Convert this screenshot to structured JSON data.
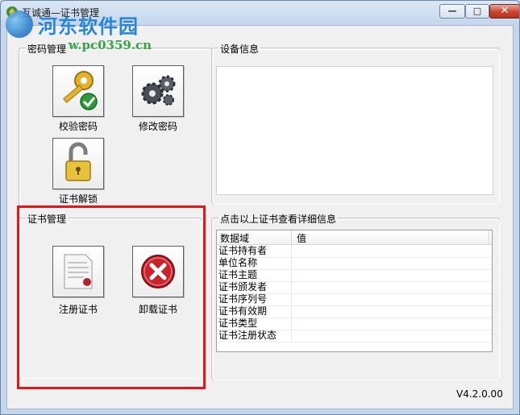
{
  "window": {
    "title": "互诚通—证书管理"
  },
  "watermark": {
    "brand": "河东软件园",
    "url": "www.pc0359.cn"
  },
  "password_group": {
    "title": "密码管理",
    "buttons": [
      {
        "label": "校验密码",
        "icon": "key-check-icon"
      },
      {
        "label": "修改密码",
        "icon": "gears-icon"
      },
      {
        "label": "证书解锁",
        "icon": "padlock-open-icon"
      }
    ]
  },
  "device_group": {
    "title": "设备信息"
  },
  "cert_group": {
    "title": "证书管理",
    "buttons": [
      {
        "label": "注册证书",
        "icon": "certificate-document-icon"
      },
      {
        "label": "卸载证书",
        "icon": "red-x-icon"
      }
    ]
  },
  "detail_group": {
    "title": "点击以上证书查看详细信息",
    "columns": [
      "数据域",
      "值"
    ],
    "rows": [
      "证书持有者",
      "单位名称",
      "证书主题",
      "证书颁发者",
      "证书序列号",
      "证书有效期",
      "证书类型",
      "证书注册状态"
    ]
  },
  "version": "V4.2.0.00",
  "colors": {
    "highlight": "#e2171b",
    "watermark_blue": "#2a86d4",
    "watermark_green": "#36a24a"
  }
}
